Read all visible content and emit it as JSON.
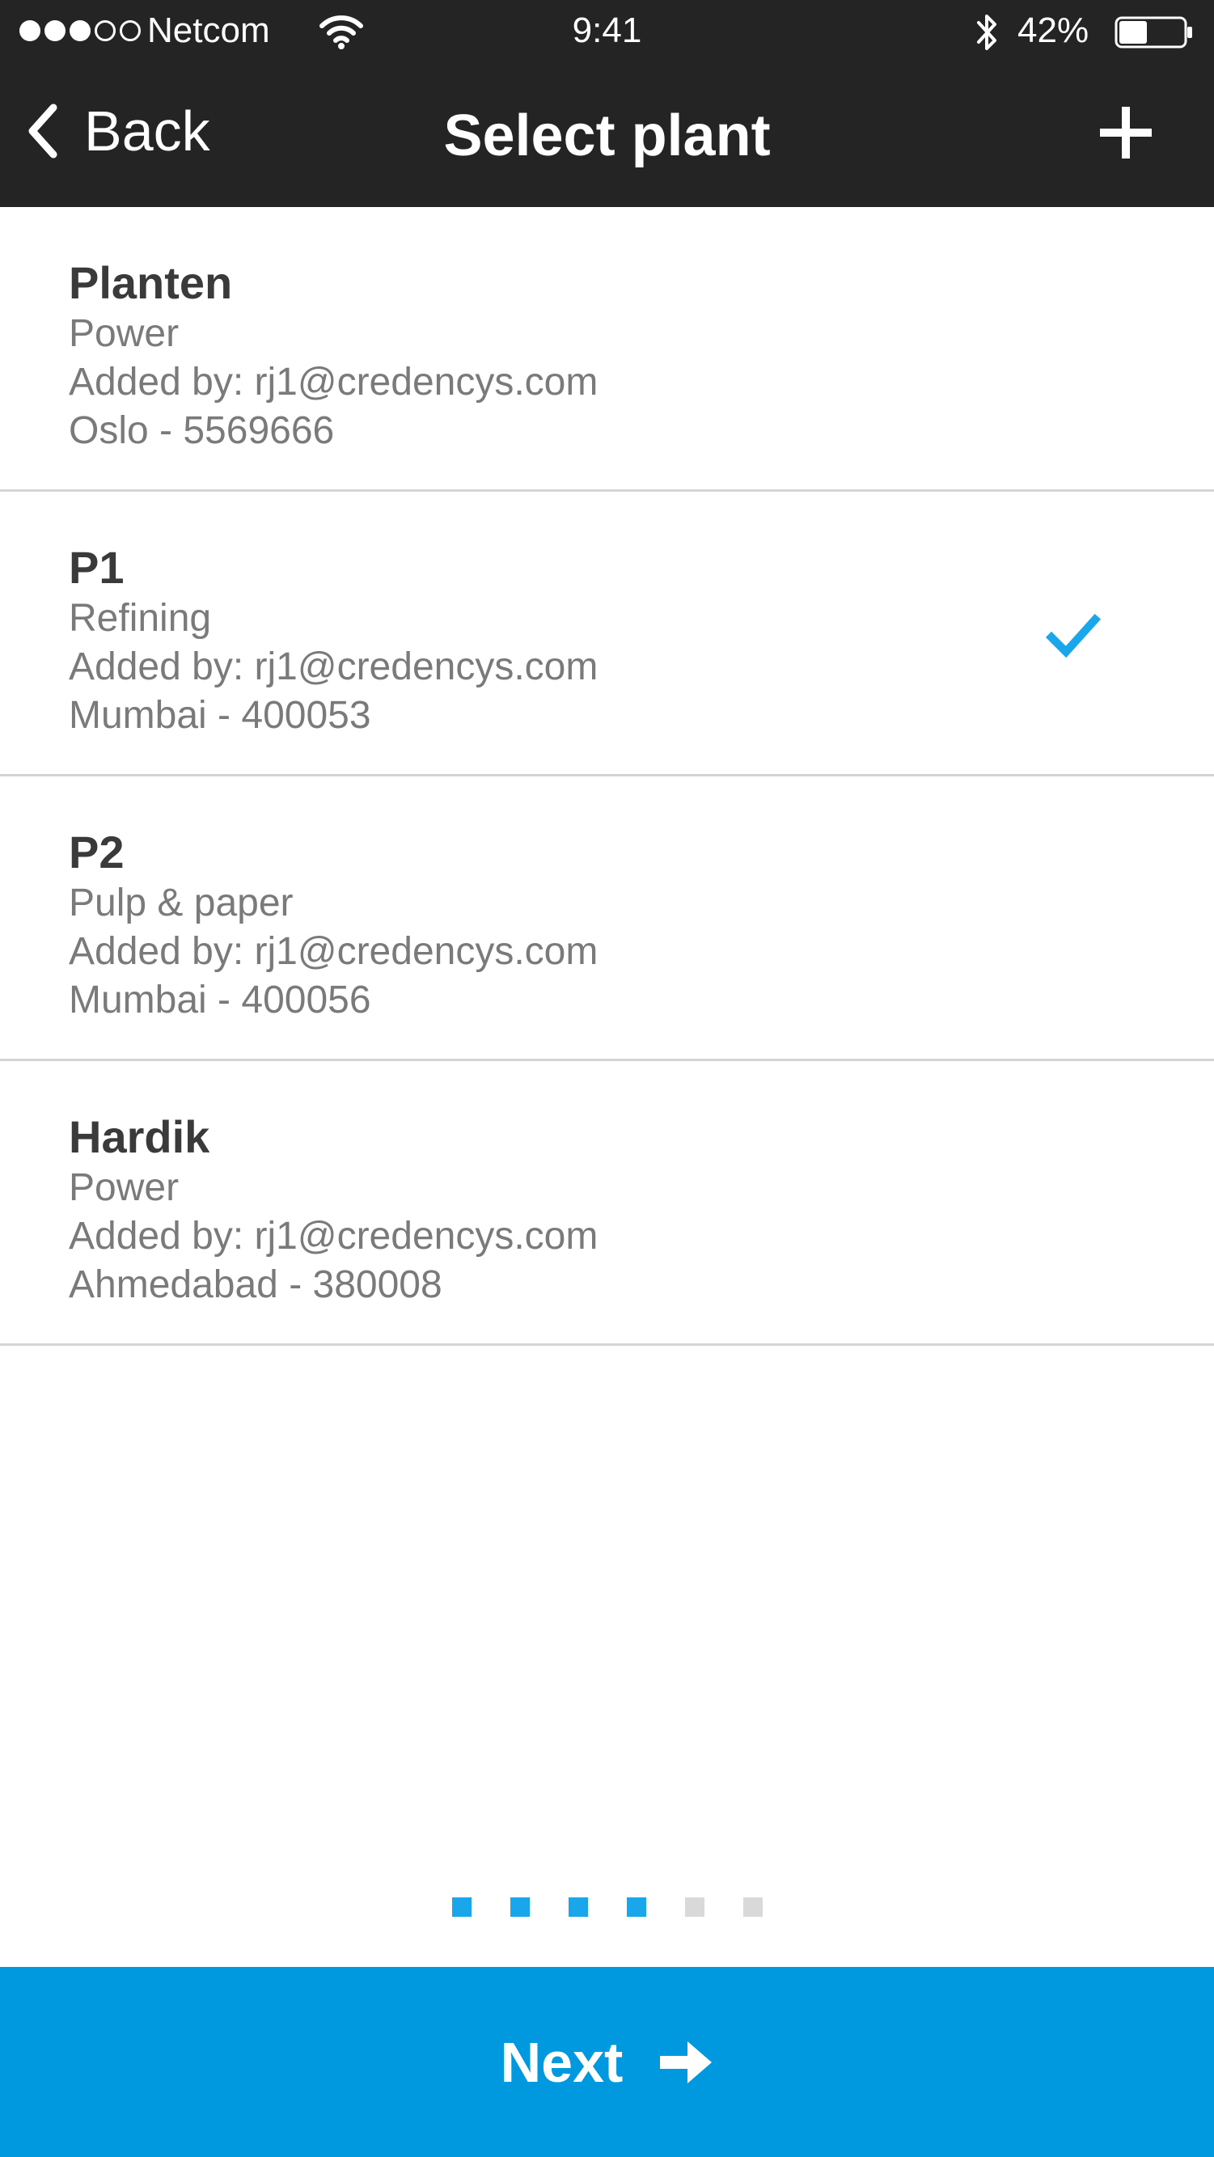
{
  "status_bar": {
    "signal_dots": [
      "full",
      "full",
      "full",
      "empty",
      "empty"
    ],
    "carrier": "Netcom",
    "time": "9:41",
    "battery_percent": "42%",
    "battery_level": 0.42
  },
  "nav": {
    "back_label": "Back",
    "title": "Select plant",
    "add_icon": "plus-icon"
  },
  "plants": [
    {
      "name": "Planten",
      "industry": "Power",
      "added_by": "Added by: rj1@credencys.com",
      "location": "Oslo - 5569666",
      "selected": false
    },
    {
      "name": "P1",
      "industry": "Refining",
      "added_by": "Added by: rj1@credencys.com",
      "location": "Mumbai - 400053",
      "selected": true
    },
    {
      "name": "P2",
      "industry": "Pulp & paper",
      "added_by": "Added by: rj1@credencys.com",
      "location": "Mumbai - 400056",
      "selected": false
    },
    {
      "name": "Hardik",
      "industry": "Power",
      "added_by": "Added by: rj1@credencys.com",
      "location": "Ahmedabad - 380008",
      "selected": false
    }
  ],
  "pagination": {
    "total_steps": 6,
    "current_step": 4
  },
  "next_button": {
    "label": "Next",
    "icon": "arrow-right-icon"
  },
  "colors": {
    "bar_background": "#242424",
    "accent": "#0098df",
    "check": "#1aa6ea",
    "pager_active": "#1aa6ea",
    "pager_inactive": "#d9d9d9",
    "divider": "#d4d4d4"
  }
}
